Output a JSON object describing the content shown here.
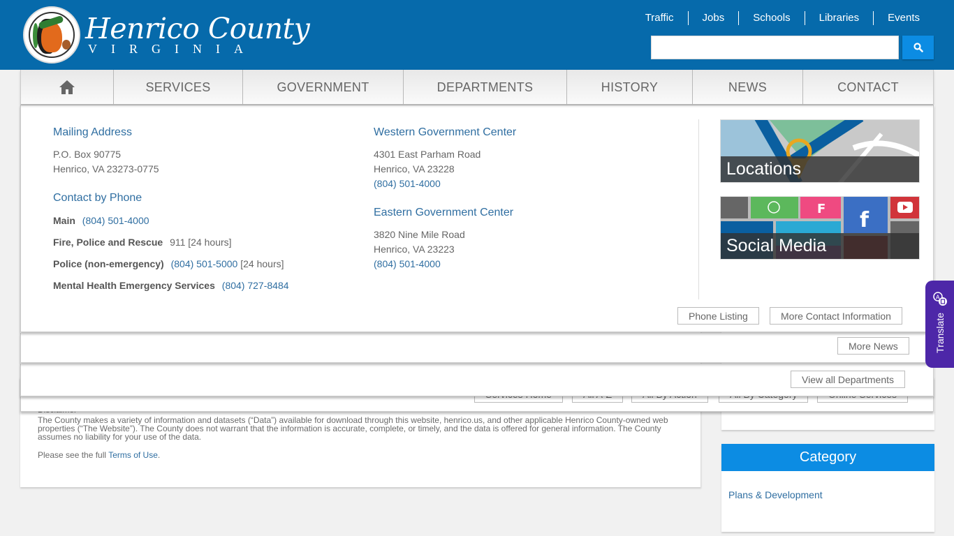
{
  "header": {
    "logo_title": "Henrico County",
    "logo_subtitle": "VIRGINIA",
    "top_links": [
      "Traffic",
      "Jobs",
      "Schools",
      "Libraries",
      "Events"
    ],
    "search": {
      "value": "",
      "placeholder": ""
    },
    "icons": {
      "search": "search-icon",
      "seal": "county-seal-icon"
    }
  },
  "nav": {
    "items": [
      {
        "label": "",
        "icon": "home-icon"
      },
      {
        "label": "SERVICES"
      },
      {
        "label": "GOVERNMENT"
      },
      {
        "label": "DEPARTMENTS"
      },
      {
        "label": "HISTORY"
      },
      {
        "label": "NEWS"
      },
      {
        "label": "CONTACT"
      }
    ]
  },
  "contact_panel": {
    "mailing": {
      "title": "Mailing Address",
      "line1": "P.O. Box 90775",
      "line2": "Henrico, VA 23273-0775"
    },
    "phone": {
      "title": "Contact by Phone",
      "rows": [
        {
          "label": "Main",
          "value": "(804) 501-4000",
          "note": ""
        },
        {
          "label": "Fire, Police and Rescue",
          "value": "911",
          "note": "[24 hours]"
        },
        {
          "label": "Police (non-emergency)",
          "value": "(804) 501-5000",
          "note": "[24 hours]"
        },
        {
          "label": "Mental Health Emergency Services",
          "value": "(804) 727-8484",
          "note": ""
        }
      ]
    },
    "western": {
      "title": "Western Government Center",
      "line1": "4301 East Parham Road",
      "line2": "Henrico, VA 23228",
      "phone": "(804) 501-4000"
    },
    "eastern": {
      "title": "Eastern Government Center",
      "line1": "3820 Nine Mile Road",
      "line2": "Henrico, VA 23223",
      "phone": "(804) 501-4000"
    },
    "tiles": [
      {
        "label": "Locations"
      },
      {
        "label": "Social Media"
      }
    ],
    "buttons": {
      "phone_listing": "Phone Listing",
      "more_contact": "More Contact Information"
    }
  },
  "news_panel": {
    "more_news": "More News"
  },
  "departments_panel": {
    "view_all": "View all Departments"
  },
  "services_panel": {
    "buttons": [
      "Services Home",
      "All A-Z",
      "All By Action",
      "All By Category",
      "Online Services"
    ]
  },
  "page": {
    "disclaimer_title": "Disclaimer",
    "disclaimer_text": "The County makes a variety of information and datasets (“Data”) available for download through this website, henrico.us, and other applicable Henrico County-owned web properties (“The Website”). The County does not warrant that the information is accurate, complete, or timely, and the data is offered for general information. The County assumes no liability for your use of the data.",
    "terms_prefix": "Please see the full ",
    "terms_link": "Terms of Use",
    "terms_suffix": ".",
    "category": {
      "title": "Category",
      "link": "Plans & Development"
    }
  },
  "translate": {
    "label": "Translate",
    "icon": "translate-icon"
  },
  "colors": {
    "header_blue": "#066aab",
    "accent_blue": "#0c8ce3",
    "link_blue": "#2f6ea1",
    "translate_purple": "#4d27a8"
  }
}
